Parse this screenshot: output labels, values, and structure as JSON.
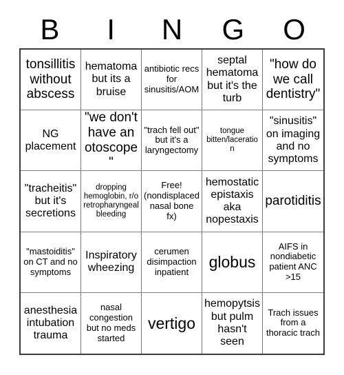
{
  "card": {
    "title": "BINGO",
    "header_letters": [
      "B",
      "I",
      "N",
      "G",
      "O"
    ],
    "columns": 5,
    "rows": 5,
    "background_color": "#ffffff",
    "text_color": "#000000",
    "grid_border_color": "#3a3a3a",
    "cell_border_color": "#7d7d7d",
    "cells": [
      {
        "text": "tonsillitis without abscess",
        "size": "lg",
        "free": false
      },
      {
        "text": "hematoma but its a bruise",
        "size": "md",
        "free": false
      },
      {
        "text": "antibiotic recs for sinusitis/AOM",
        "size": "sm",
        "free": false
      },
      {
        "text": "septal hematoma but it's the turb",
        "size": "md",
        "free": false
      },
      {
        "text": "\"how do we call dentistry\"",
        "size": "lg",
        "free": false
      },
      {
        "text": "NG placement",
        "size": "md",
        "free": false
      },
      {
        "text": "\"we don't have an otoscope\"",
        "size": "lg",
        "free": false
      },
      {
        "text": "\"trach fell out\" but it's a laryngectomy",
        "size": "sm",
        "free": false
      },
      {
        "text": "tongue bitten/laceration",
        "size": "xs",
        "free": false
      },
      {
        "text": "\"sinusitis\" on imaging and no symptoms",
        "size": "md",
        "free": false
      },
      {
        "text": "\"tracheitis\" but it's secretions",
        "size": "md",
        "free": false
      },
      {
        "text": "dropping hemoglobin, r/o retropharyngeal bleeding",
        "size": "xs",
        "free": false
      },
      {
        "text": "Free! (nondisplaced nasal bone fx)",
        "size": "sm",
        "free": true
      },
      {
        "text": "hemostatic epistaxis aka nopestaxis",
        "size": "md",
        "free": false
      },
      {
        "text": "parotiditis",
        "size": "lg",
        "free": false
      },
      {
        "text": "\"mastoiditis\" on CT and no symptoms",
        "size": "sm",
        "free": false
      },
      {
        "text": "Inspiratory wheezing",
        "size": "md",
        "free": false
      },
      {
        "text": "cerumen disimpaction inpatient",
        "size": "sm",
        "free": false
      },
      {
        "text": "globus",
        "size": "xl",
        "free": false
      },
      {
        "text": "AIFS in nondiabetic patient ANC >15",
        "size": "sm",
        "free": false
      },
      {
        "text": "anesthesia intubation trauma",
        "size": "md",
        "free": false
      },
      {
        "text": "nasal congestion but no meds started",
        "size": "sm",
        "free": false
      },
      {
        "text": "vertigo",
        "size": "xl",
        "free": false
      },
      {
        "text": "hemopytsis but pulm hasn't seen",
        "size": "md",
        "free": false
      },
      {
        "text": "Trach issues from a thoracic trach",
        "size": "sm",
        "free": false
      }
    ]
  }
}
